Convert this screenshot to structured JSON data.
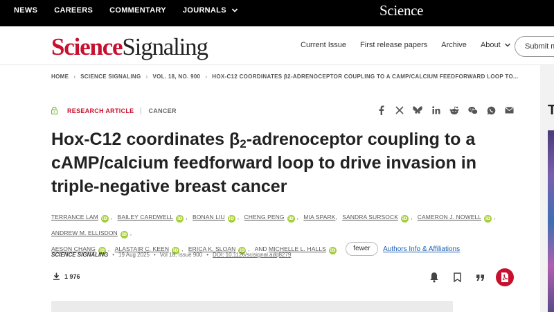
{
  "topbar": {
    "nav": [
      "NEWS",
      "CAREERS",
      "COMMENTARY",
      "JOURNALS"
    ],
    "logo": "Science"
  },
  "header": {
    "brand_part1": "Science",
    "brand_part2": "Signaling",
    "nav": [
      "Current Issue",
      "First release papers",
      "Archive",
      "About"
    ],
    "submit_label": "Submit m"
  },
  "breadcrumb": [
    "HOME",
    "SCIENCE SIGNALING",
    "VOL. 18, NO. 900",
    "HOX-C12 COORDINATES β2-ADRENOCEPTOR COUPLING TO A CAMP/CALCIUM FEEDFORWARD LOOP TO..."
  ],
  "article": {
    "type_label": "RESEARCH ARTICLE",
    "category": "CANCER",
    "title_part1": "Hox-C12 coordinates β",
    "title_sub": "2",
    "title_part2": "-adrenoceptor coupling to a cAMP/calcium feedforward loop to drive invasion in triple-negative breast cancer",
    "authors": [
      "TERRANCE LAM",
      "BAILEY CARDWELL",
      "BONAN LIU",
      "CHENG PENG",
      "MIA SPARK",
      "SANDRA SURSOCK",
      "CAMERON J. NOWELL",
      "ANDREW M. ELLISDON",
      "AESON CHANG",
      "ALASTAIR C. KEEN",
      "ERICA K. SLOAN",
      "MICHELLE L. HALLS"
    ],
    "and_text": "AND",
    "fewer_label": "fewer",
    "affiliations_label": "Authors Info & Affiliations",
    "journal": "SCIENCE SIGNALING",
    "date": "19 Aug 2025",
    "volume": "Vol 18, Issue 900",
    "doi": "DOI: 10.1126/scisignal.adq8279",
    "downloads": "1 976"
  },
  "side": {
    "title_fragment": "T"
  },
  "colors": {
    "brand_red": "#c8102e",
    "orcid_green": "#a6ce39",
    "link_blue": "#1a5fb4"
  },
  "icons": {
    "share": [
      "facebook-icon",
      "x-icon",
      "bluesky-icon",
      "linkedin-icon",
      "reddit-icon",
      "wechat-icon",
      "whatsapp-icon",
      "email-icon"
    ],
    "actions": [
      "bell-icon",
      "bookmark-icon",
      "cite-icon",
      "pdf-icon"
    ]
  }
}
